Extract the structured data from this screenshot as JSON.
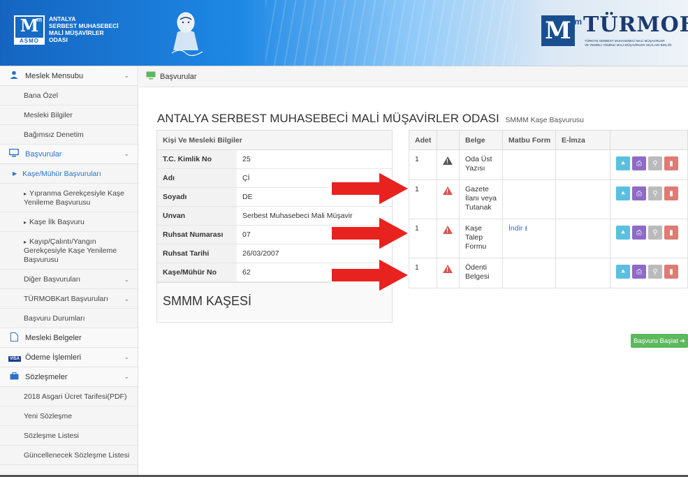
{
  "header": {
    "asmo_text": "ANTALYA\nSERBEST MUHASEBECİ\nMALİ MÜŞAVİRLER\nODASI",
    "asmo_mark": "M",
    "asmo_sup": "m",
    "asmo_sub": "ASMO",
    "turmob_mark": "M",
    "turmob_sup": "m",
    "turmob_name": "TÜRMOB",
    "turmob_sub": "TÜRKİYE SERBEST MUHASEBECİ MALİ MÜŞAVİRLER\nVE YEMİNLİ YEMİNLİ MALİ MÜŞAVİRLER ODALARI BİRLİĞİ"
  },
  "sidebar": {
    "meslek_mensubu": "Meslek Mensubu",
    "bana_ozel": "Bana Özel",
    "mesleki_bilgiler": "Mesleki Bilgiler",
    "bagimsiz_denetim": "Bağımsız Denetim",
    "basvurular": "Başvurular",
    "kase_muhur": "Kaşe/Mühür Başvuruları",
    "yipranma": "Yıpranma Gerekçesiyle Kaşe Yenileme Başvurusu",
    "kase_ilk": "Kaşe İlk Başvuru",
    "kayip": "Kayıp/Çalıntı/Yangın Gerekçesiyle Kaşe Yenileme Başvurusu",
    "diger": "Diğer Başvuruları",
    "turmobkart": "TÜRMOBKart Başvuruları",
    "durum": "Başvuru Durumları",
    "mesleki_belgeler": "Mesleki Belgeler",
    "odeme": "Ödeme İşlemleri",
    "sozlesmeler": "Sözleşmeler",
    "asgari": "2018 Asgari Ücret Tarifesi(PDF)",
    "yeni_sozlesme": "Yeni Sözleşme",
    "sozlesme_listesi": "Sözleşme Listesi",
    "guncellenecek": "Güncellenecek Sözleşme Listesi",
    "visa_label": "VISA"
  },
  "breadcrumb": "Başvurular",
  "title": "ANTALYA SERBEST MUHASEBECİ MALİ MÜŞAVİRLER ODASI",
  "subtitle": "SMMM Kaşe Başvurusu",
  "info_panel": {
    "heading": "Kişi Ve Mesleki Bilgiler",
    "rows": [
      {
        "k": "T.C. Kimlik No",
        "v": "25"
      },
      {
        "k": "Adı",
        "v": "Çİ"
      },
      {
        "k": "Soyadı",
        "v": "DE"
      },
      {
        "k": "Unvan",
        "v": "Serbest Muhasebeci Mali Müşavir"
      },
      {
        "k": "Ruhsat Numarası",
        "v": "07"
      },
      {
        "k": "Ruhsat Tarihi",
        "v": "26/03/2007"
      },
      {
        "k": "Kaşe/Mühür No",
        "v": "62"
      }
    ],
    "kase_title": "SMMM KAŞESİ"
  },
  "doc_table": {
    "headers": [
      "Adet",
      "",
      "Belge",
      "Matbu Form",
      "E-İmza",
      ""
    ],
    "rows": [
      {
        "adet": "1",
        "warn": "gray",
        "belge": "Oda Üst Yazısı",
        "matbu": "",
        "eimza": ""
      },
      {
        "adet": "1",
        "warn": "red",
        "belge": "Gazete İlanı veya Tutanak",
        "matbu": "",
        "eimza": ""
      },
      {
        "adet": "1",
        "warn": "red",
        "belge": "Kaşe Talep Formu",
        "matbu": "İndir",
        "eimza": ""
      },
      {
        "adet": "1",
        "warn": "red",
        "belge": "Ödenti Belgesi",
        "matbu": "",
        "eimza": ""
      }
    ]
  },
  "basla_button": "Başvuru Başlat",
  "colors": {
    "accent": "#2a72c7",
    "warning": "#d9534f",
    "success": "#5cb85c",
    "arrow": "#e8221f"
  }
}
